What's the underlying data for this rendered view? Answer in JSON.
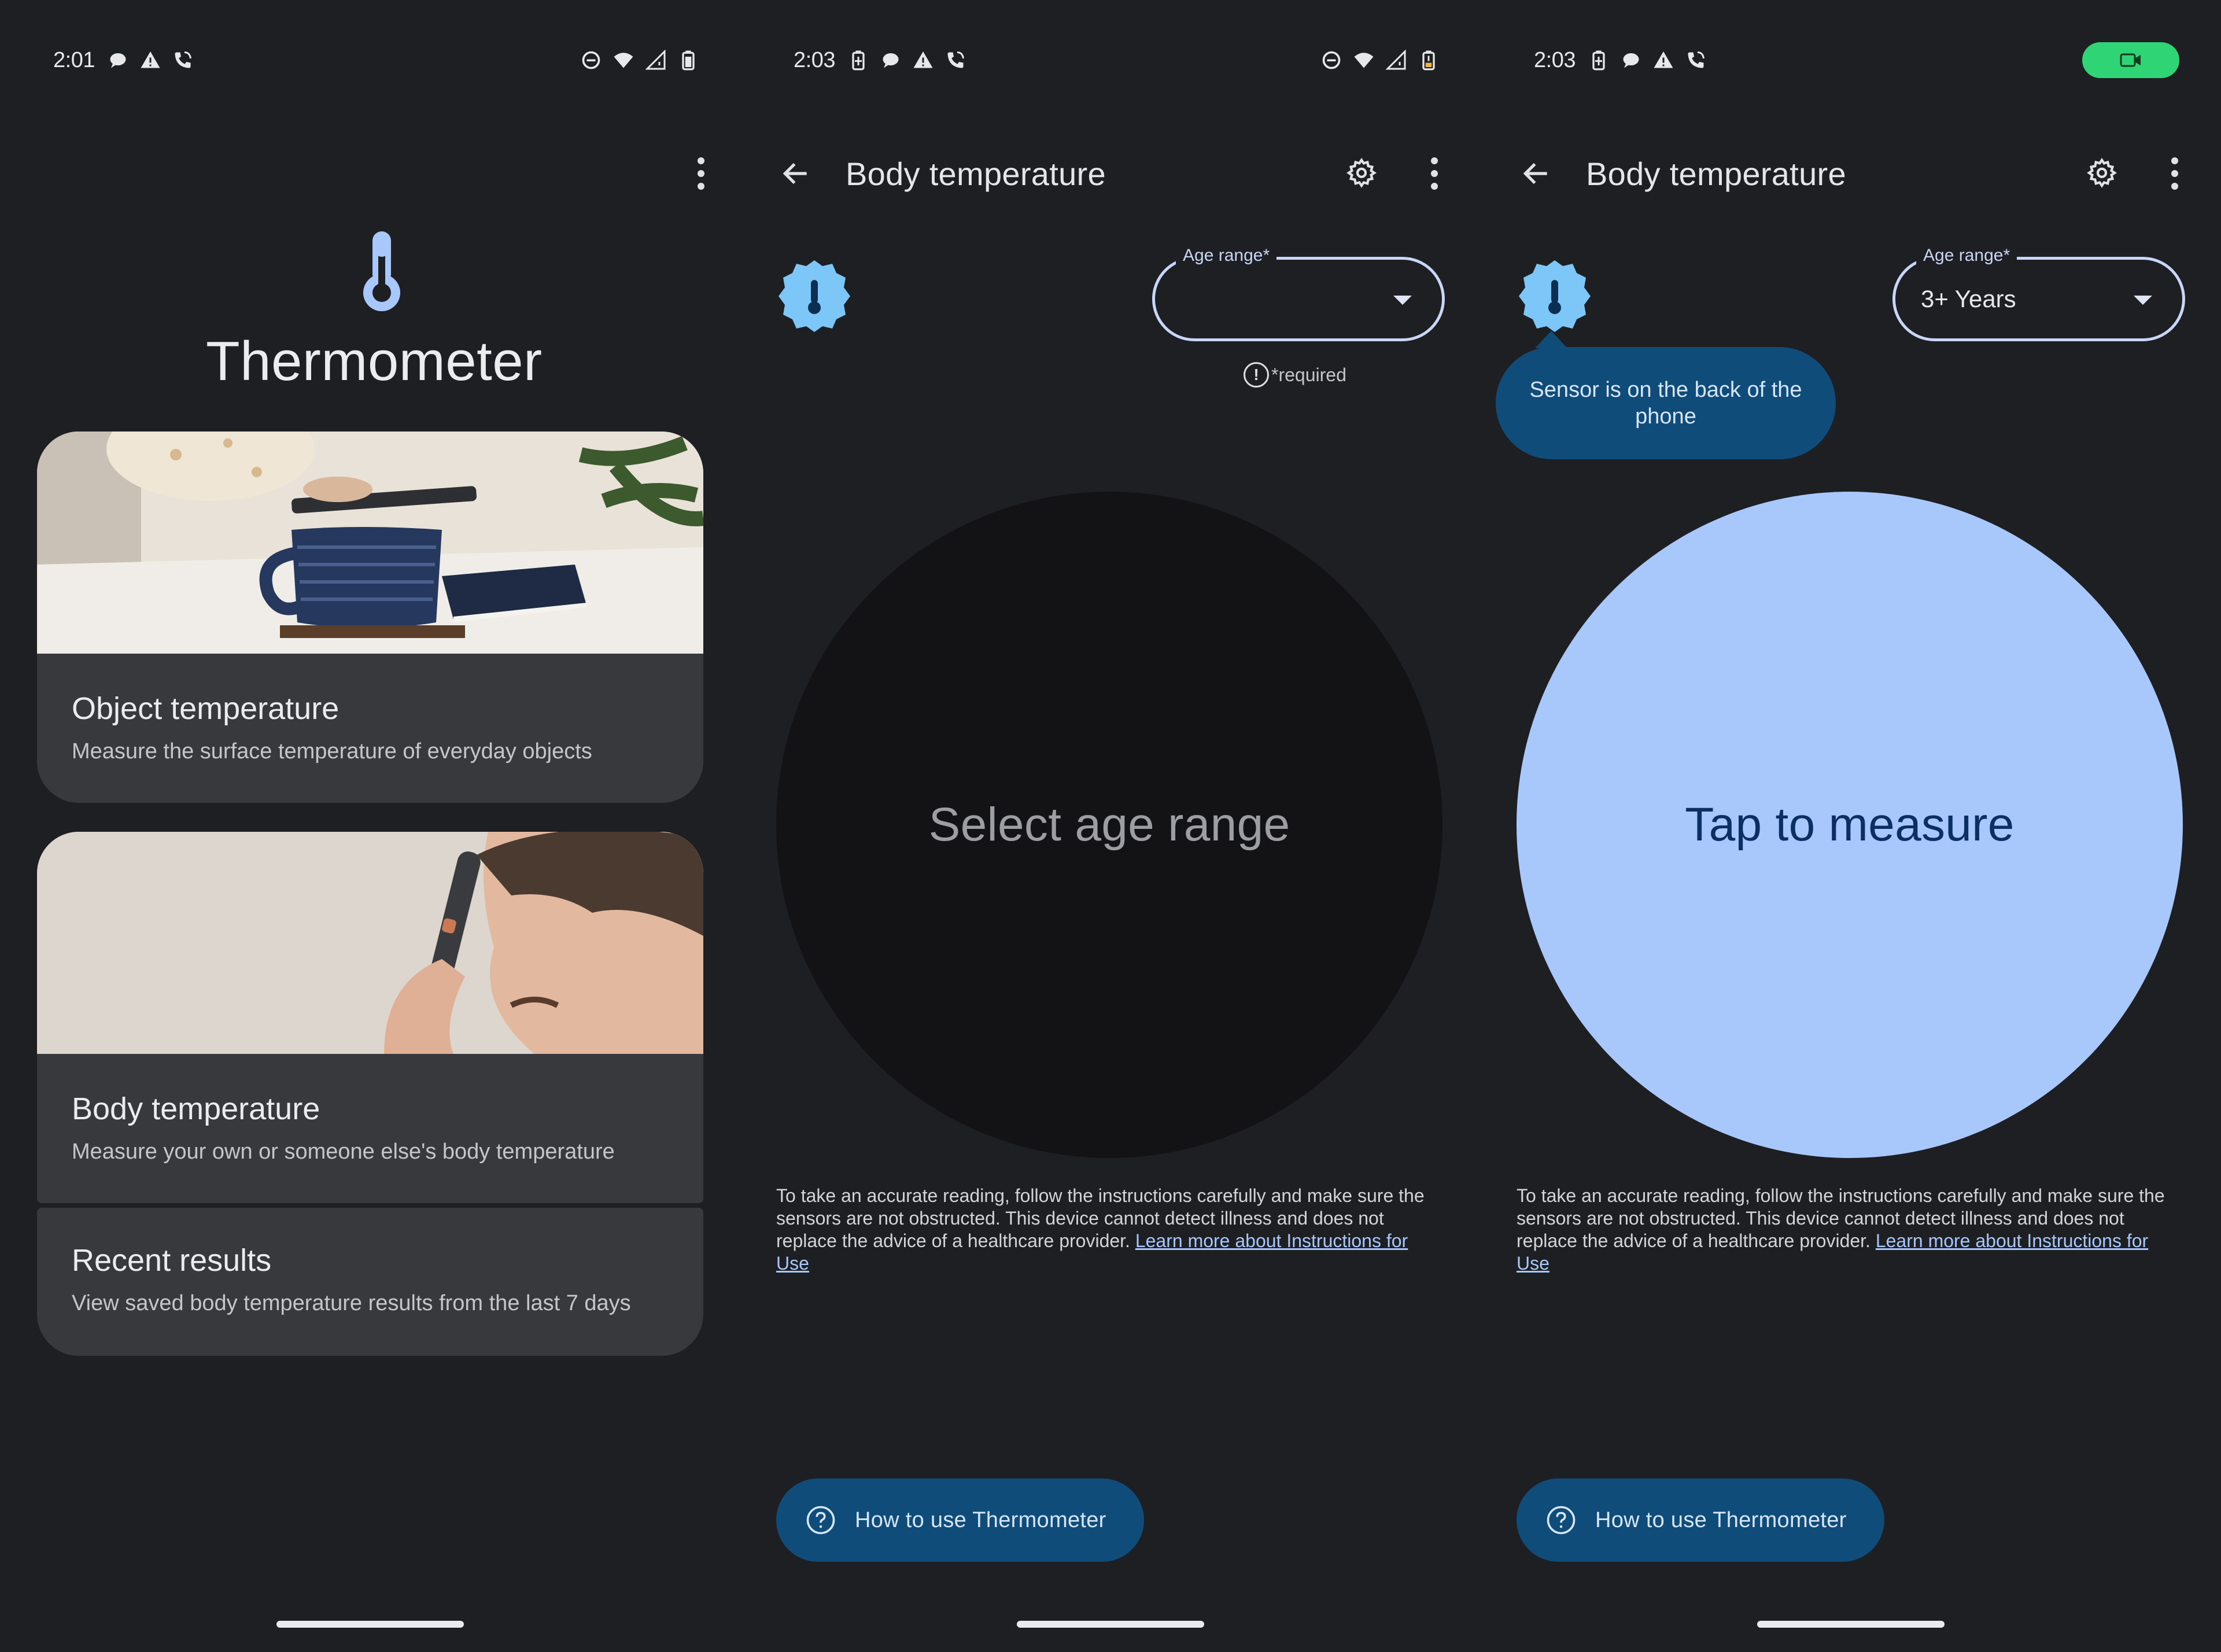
{
  "panels": [
    {
      "status": {
        "time": "2:01"
      },
      "app_title": "Thermometer",
      "cards": [
        {
          "title": "Object temperature",
          "subtitle": "Measure the surface temperature of everyday objects"
        },
        {
          "title": "Body temperature",
          "subtitle": "Measure your own or someone else's body temperature"
        },
        {
          "title": "Recent results",
          "subtitle": "View saved body temperature results from the last 7 days"
        }
      ]
    },
    {
      "status": {
        "time": "2:03"
      },
      "title": "Body temperature",
      "dropdown": {
        "label": "Age range*",
        "value": ""
      },
      "required_text": "*required",
      "circle_text": "Select age range",
      "disclaimer": "To take an accurate reading, follow the instructions carefully and make sure the sensors are not obstructed. This device cannot detect illness and does not replace the advice of a healthcare provider. ",
      "disclaimer_link": "Learn more about Instructions for Use",
      "howto_label": "How to use Thermometer"
    },
    {
      "status": {
        "time": "2:03"
      },
      "title": "Body temperature",
      "dropdown": {
        "label": "Age range*",
        "value": "3+ Years"
      },
      "tooltip": "Sensor is on the back of the phone",
      "circle_text": "Tap to measure",
      "disclaimer": "To take an accurate reading, follow the instructions carefully and make sure the sensors are not obstructed. This device cannot detect illness and does not replace the advice of a healthcare provider. ",
      "disclaimer_link": "Learn more about Instructions for Use",
      "howto_label": "How to use Thermometer"
    }
  ],
  "colors": {
    "background": "#1e1f22",
    "card": "#38393d",
    "accent_light": "#a8c7fa",
    "button_dark_blue": "#0f4c7a",
    "recording_green": "#2fd575"
  },
  "icons": [
    "thermometer-icon",
    "back-arrow-icon",
    "gear-icon",
    "more-vert-icon",
    "help-circle-icon",
    "chevron-down-icon",
    "video-camera-icon",
    "wifi-icon",
    "battery-icon",
    "dnd-icon",
    "signal-icon",
    "alert-icon",
    "phone-call-icon",
    "chat-bubble-icon"
  ]
}
